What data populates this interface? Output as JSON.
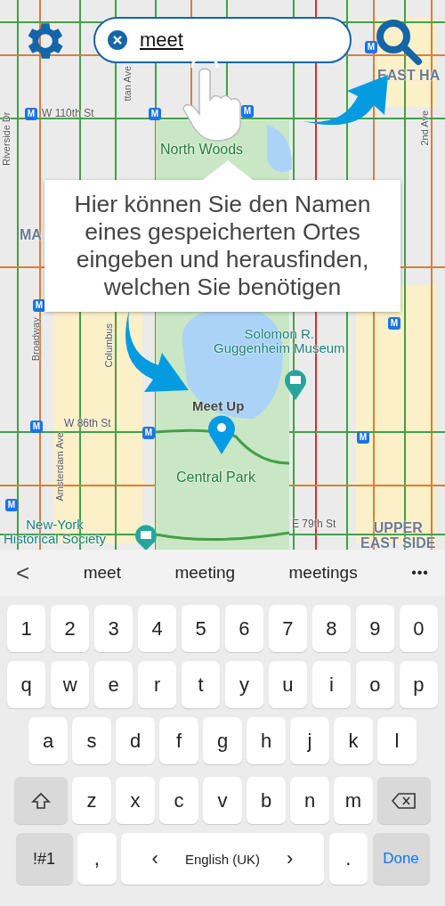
{
  "map": {
    "labels": [
      {
        "text": "W 110th St",
        "kind": "street"
      },
      {
        "text": "ttan Ave",
        "kind": "street-vertical"
      },
      {
        "text": "Riverside Dr",
        "kind": "street-vertical"
      },
      {
        "text": "North Woods",
        "kind": "park"
      },
      {
        "text": "EAST HA",
        "kind": "district"
      },
      {
        "text": "2nd Ave",
        "kind": "street-vertical"
      },
      {
        "text": "MA",
        "kind": "district"
      },
      {
        "text": "Broadway",
        "kind": "street-vertical"
      },
      {
        "text": "Columbus",
        "kind": "street-vertical"
      },
      {
        "text": "Solomon R.\nGuggenheim Museum",
        "kind": "poi"
      },
      {
        "text": "W 86th St",
        "kind": "street"
      },
      {
        "text": "Amsterdam Ave",
        "kind": "street-vertical"
      },
      {
        "text": "Central Park",
        "kind": "park"
      },
      {
        "text": "New-York\nHistorical Society",
        "kind": "poi"
      },
      {
        "text": "E 79th St",
        "kind": "street"
      },
      {
        "text": "UPPER\nEAST SIDE",
        "kind": "district"
      }
    ],
    "metro_stations": [
      "M",
      "M",
      "M",
      "M",
      "M",
      "M",
      "M",
      "M",
      "M",
      "M"
    ],
    "marker": {
      "label": "Meet Up"
    }
  },
  "search": {
    "value": "meet"
  },
  "tooltip": "Hier können Sie den Namen eines gespeicherten Ortes eingeben und herausfinden, welchen Sie benötigen",
  "keyboard": {
    "back": "<",
    "suggestions": [
      "meet",
      "meeting",
      "meetings"
    ],
    "more": "•••",
    "rows": [
      [
        {
          "label": "1",
          "kind": "char"
        },
        {
          "label": "2",
          "kind": "char"
        },
        {
          "label": "3",
          "kind": "char"
        },
        {
          "label": "4",
          "kind": "char"
        },
        {
          "label": "5",
          "kind": "char"
        },
        {
          "label": "6",
          "kind": "char"
        },
        {
          "label": "7",
          "kind": "char"
        },
        {
          "label": "8",
          "kind": "char"
        },
        {
          "label": "9",
          "kind": "char"
        },
        {
          "label": "0",
          "kind": "char"
        }
      ],
      [
        {
          "label": "q",
          "kind": "char"
        },
        {
          "label": "w",
          "kind": "char"
        },
        {
          "label": "e",
          "kind": "char"
        },
        {
          "label": "r",
          "kind": "char"
        },
        {
          "label": "t",
          "kind": "char"
        },
        {
          "label": "y",
          "kind": "char"
        },
        {
          "label": "u",
          "kind": "char"
        },
        {
          "label": "i",
          "kind": "char"
        },
        {
          "label": "o",
          "kind": "char"
        },
        {
          "label": "p",
          "kind": "char"
        }
      ],
      [
        {
          "label": "a",
          "kind": "char"
        },
        {
          "label": "s",
          "kind": "char"
        },
        {
          "label": "d",
          "kind": "char"
        },
        {
          "label": "f",
          "kind": "char"
        },
        {
          "label": "g",
          "kind": "char"
        },
        {
          "label": "h",
          "kind": "char"
        },
        {
          "label": "j",
          "kind": "char"
        },
        {
          "label": "k",
          "kind": "char"
        },
        {
          "label": "l",
          "kind": "char"
        }
      ],
      [
        {
          "kind": "shift"
        },
        {
          "label": "z",
          "kind": "char"
        },
        {
          "label": "x",
          "kind": "char"
        },
        {
          "label": "c",
          "kind": "char"
        },
        {
          "label": "v",
          "kind": "char"
        },
        {
          "label": "b",
          "kind": "char"
        },
        {
          "label": "n",
          "kind": "char"
        },
        {
          "label": "m",
          "kind": "char"
        },
        {
          "kind": "backspace"
        }
      ]
    ],
    "bottom_row": [
      {
        "label": "!#1",
        "kind": "function"
      },
      {
        "label": ",",
        "kind": "char"
      },
      {
        "kind": "space",
        "label": "English (UK)",
        "left": "‹",
        "right": "›"
      },
      {
        "label": ".",
        "kind": "char"
      },
      {
        "label": "Done",
        "kind": "done"
      }
    ]
  }
}
